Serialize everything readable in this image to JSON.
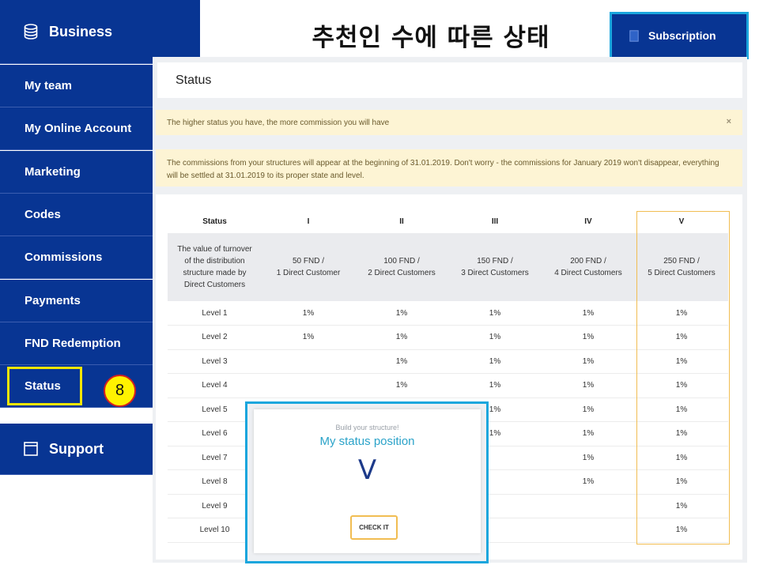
{
  "slide_title": "추천인 수에 따른  상태",
  "sidebar": {
    "header": "Business",
    "items": [
      {
        "label": "My team"
      },
      {
        "label": "My Online Account"
      },
      {
        "label": "Marketing"
      },
      {
        "label": "Codes"
      },
      {
        "label": "Commissions"
      },
      {
        "label": "Payments"
      },
      {
        "label": "FND Redemption"
      },
      {
        "label": "Status"
      }
    ],
    "support": "Support",
    "step_badge": "8"
  },
  "subscription": "Subscription",
  "status_header": "Status",
  "notices": {
    "first": "The higher status you have, the more commission you will have",
    "first_close": "×",
    "second": "The commissions from your structures will appear at the beginning of 31.01.2019. Don't worry - the commissions for January 2019 won't disappear, everything will be settled at 31.01.2019 to its proper state and level."
  },
  "table": {
    "headers": [
      "Status",
      "I",
      "II",
      "III",
      "IV",
      "V"
    ],
    "turnover": [
      "The value of turnover of the distribution structure made by Direct Customers",
      "50 FND /\n1 Direct Customer",
      "100 FND /\n2 Direct Customers",
      "150 FND /\n3 Direct Customers",
      "200 FND /\n4 Direct Customers",
      "250 FND /\n5 Direct Customers"
    ],
    "levels": [
      [
        "Level 1",
        "1%",
        "1%",
        "1%",
        "1%",
        "1%"
      ],
      [
        "Level 2",
        "1%",
        "1%",
        "1%",
        "1%",
        "1%"
      ],
      [
        "Level 3",
        "",
        "1%",
        "1%",
        "1%",
        "1%"
      ],
      [
        "Level 4",
        "",
        "1%",
        "1%",
        "1%",
        "1%"
      ],
      [
        "Level 5",
        "",
        "",
        "1%",
        "1%",
        "1%"
      ],
      [
        "Level 6",
        "",
        "",
        "1%",
        "1%",
        "1%"
      ],
      [
        "Level 7",
        "",
        "",
        "",
        "1%",
        "1%"
      ],
      [
        "Level 8",
        "",
        "",
        "",
        "1%",
        "1%"
      ],
      [
        "Level 9",
        "",
        "",
        "",
        "",
        "1%"
      ],
      [
        "Level 10",
        "",
        "",
        "",
        "",
        "1%"
      ]
    ]
  },
  "popup": {
    "subtitle": "Build your structure!",
    "title": "My status position",
    "value": "V",
    "button": "CHECK IT"
  },
  "colors": {
    "sidebar_bg": "#083593",
    "highlight_yellow": "#f3e600",
    "highlight_blue": "#1ba6dd",
    "accent_orange": "#f1bd52",
    "notice_bg": "#fdf4d4"
  },
  "icons": {
    "business": "database-icon",
    "support": "window-icon",
    "subscription": "document-icon"
  }
}
